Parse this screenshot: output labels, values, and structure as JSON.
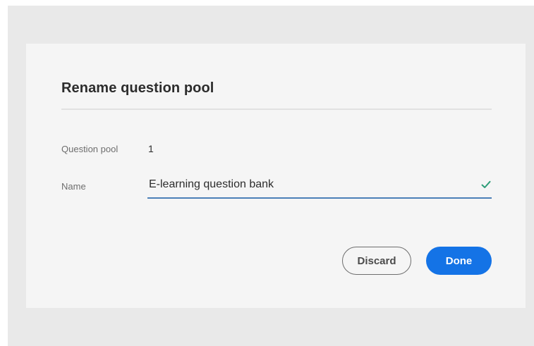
{
  "dialog": {
    "title": "Rename question pool",
    "question_pool": {
      "label": "Question pool",
      "value": "1"
    },
    "name": {
      "label": "Name",
      "value": "E-learning question bank",
      "valid_icon": "checkmark-icon"
    },
    "buttons": {
      "discard_label": "Discard",
      "done_label": "Done"
    }
  },
  "colors": {
    "overlay": "#e9e9e9",
    "dialog_background": "#f5f5f5",
    "accent": "#1473e6",
    "valid": "#2d9d78",
    "input_underline": "#4b7fb8"
  }
}
